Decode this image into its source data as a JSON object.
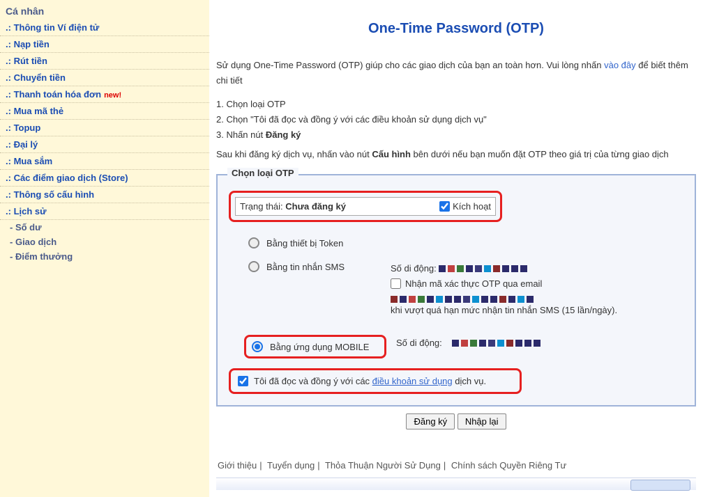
{
  "sidebar": {
    "header": "Cá nhân",
    "items": [
      {
        "label": "Thông tin Ví điện tử"
      },
      {
        "label": "Nạp tiền"
      },
      {
        "label": "Rút tiền"
      },
      {
        "label": "Chuyển tiền"
      },
      {
        "label": "Thanh toán hóa đơn",
        "new": "new!"
      },
      {
        "label": "Mua mã thẻ"
      },
      {
        "label": "Topup"
      },
      {
        "label": "Đại lý"
      },
      {
        "label": "Mua sắm"
      },
      {
        "label": "Các điểm giao dịch (Store)"
      },
      {
        "label": "Thông số cấu hình"
      },
      {
        "label": "Lịch sử"
      }
    ],
    "subitems": [
      {
        "label": "Số dư"
      },
      {
        "label": "Giao dịch"
      },
      {
        "label": "Điểm thưởng"
      }
    ]
  },
  "main": {
    "title": "One-Time Password (OTP)",
    "intro_prefix": "Sử dụng One-Time Password (OTP) giúp cho các giao dịch của bạn an toàn hơn. Vui lòng nhấn ",
    "intro_link": "vào đây",
    "intro_suffix": " để biết thêm chi tiết",
    "steps": {
      "s1": "1. Chọn loại OTP",
      "s2": "2. Chọn \"Tôi đã đọc và đồng ý với các điều khoản sử dụng dịch vụ\"",
      "s3_pre": "3. Nhấn nút ",
      "s3_b": "Đăng ký"
    },
    "after_pre": "Sau khi đăng ký dịch vụ, nhấn vào nút ",
    "after_b": "Cấu hình",
    "after_suf": " bên dưới nếu bạn muốn đặt OTP theo giá trị của từng giao dịch",
    "fieldset_legend": "Chọn loại OTP",
    "status": {
      "label": "Trạng thái: ",
      "value": "Chưa đăng ký",
      "activate": "Kích hoạt"
    },
    "options": {
      "token": "Bằng thiết bị Token",
      "sms": "Bằng tin nhắn SMS",
      "sms_mobile_label": "Số di động:",
      "sms_email_cb": "Nhận mã xác thực OTP qua email",
      "sms_email_limit": "khi vượt quá hạn mức nhận tin nhắn SMS (15 lần/ngày).",
      "mobile": "Bằng ứng dụng MOBILE",
      "mobile_mobile_label": "Số di động:"
    },
    "agree_pre": "Tôi đã đọc và đồng ý với các ",
    "agree_link": "điều khoản sử dụng",
    "agree_suf": " dịch vụ.",
    "buttons": {
      "register": "Đăng ký",
      "reset": "Nhập lại"
    }
  },
  "footer": {
    "links": [
      "Giới thiệu",
      "Tuyển dụng",
      "Thỏa Thuận Người Sử Dụng",
      "Chính sách Quyền Riêng Tư"
    ]
  },
  "masked_colors": {
    "phone1": [
      "#2b2a6b",
      "#c04040",
      "#3a7a3a",
      "#2b2a6b",
      "#3a3a7a",
      "#0d90d0",
      "#8a2b2b",
      "#2b2a6b",
      "#2b2a6b",
      "#2b2a6b"
    ],
    "email": [
      "#8a2b2b",
      "#2b2a6b",
      "#c04040",
      "#3a7a3a",
      "#2b2a6b",
      "#0d90d0",
      "#2b2a6b",
      "#2b2a6b",
      "#3a3a7a",
      "#0d90d0",
      "#2b2a6b",
      "#2b2a6b",
      "#8a2b2b",
      "#2b2a6b",
      "#0d90d0",
      "#2b2a6b"
    ],
    "phone2": [
      "#2b2a6b",
      "#c04040",
      "#3a7a3a",
      "#2b2a6b",
      "#3a3a7a",
      "#0d90d0",
      "#8a2b2b",
      "#2b2a6b",
      "#2b2a6b",
      "#2b2a6b"
    ]
  }
}
